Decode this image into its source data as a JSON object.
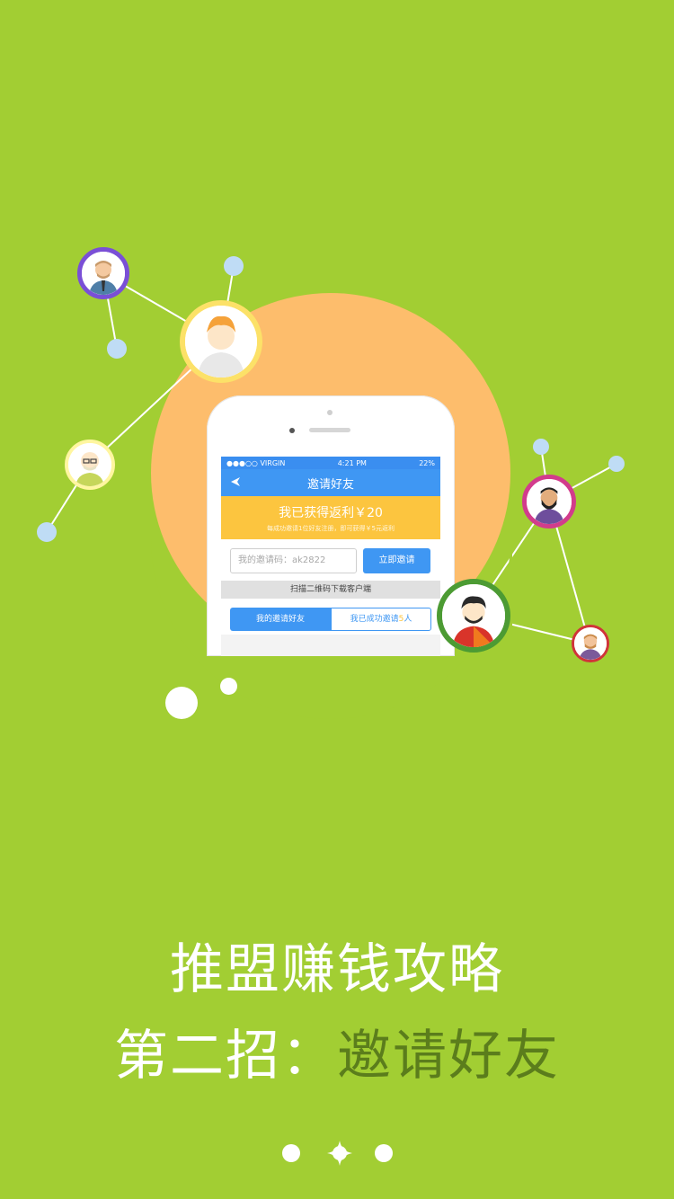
{
  "colors": {
    "background": "#a2ce33",
    "circle": "#fdbd6c",
    "app_blue": "#3f97f3",
    "app_yellow": "#fcc53f",
    "title_accent": "#5b7d1c",
    "node_blue": "#bfdcf5"
  },
  "phone": {
    "status": {
      "carrier": "●●●○○ VIRGIN",
      "time": "4:21 PM",
      "battery": "22%"
    },
    "nav_title": "邀请好友",
    "back_icon": "back-arrow-icon",
    "earn_title": "我已获得返利￥20",
    "earn_subtitle": "每成功邀请1位好友注册，即可获得￥5元返利",
    "code_placeholder": "我的邀请码：ak2822",
    "invite_button": "立即邀请",
    "scan_text": "扫描二维码下载客户端",
    "tab_my_invites": "我的邀请好友",
    "tab_success_prefix": "我已成功邀请",
    "tab_success_count": "5",
    "tab_success_suffix": "人"
  },
  "headline": {
    "line1": "推盟赚钱攻略",
    "line2_prefix": "第二招：",
    "line2_accent": "邀请好友"
  },
  "pager": {
    "pages": 3,
    "current": 2
  }
}
